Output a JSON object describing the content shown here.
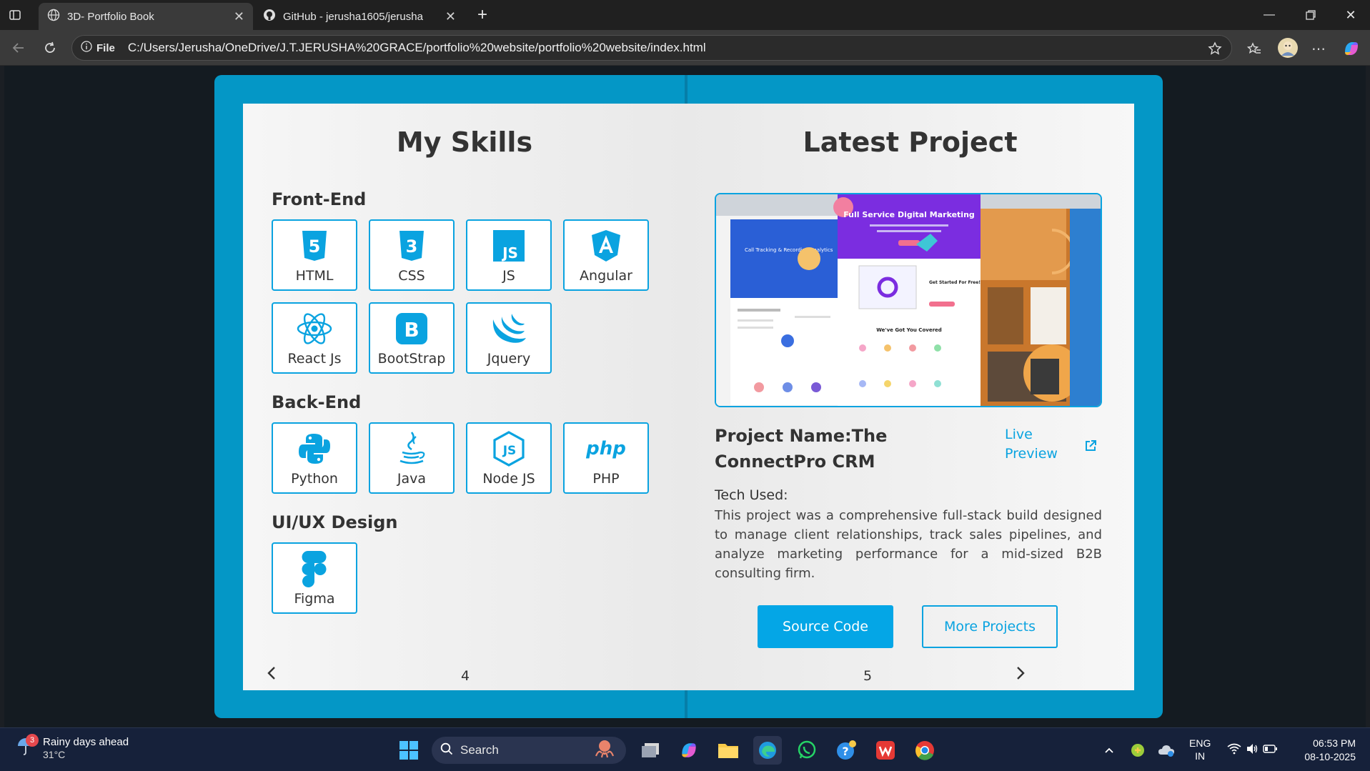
{
  "browser": {
    "tabs": [
      {
        "title": "3D- Portfolio Book",
        "active": true,
        "icon": "globe-icon"
      },
      {
        "title": "GitHub - jerusha1605/jerusha",
        "active": false,
        "icon": "github-icon"
      }
    ],
    "address": {
      "scheme_label": "File",
      "url": "C:/Users/Jerusha/OneDrive/J.T.JERUSHA%20GRACE/portfolio%20website/portfolio%20website/index.html"
    }
  },
  "left_page": {
    "title": "My Skills",
    "sections": {
      "frontend": {
        "title": "Front-End",
        "skills": [
          {
            "label": "HTML",
            "icon": "html5-icon"
          },
          {
            "label": "CSS",
            "icon": "css3-icon"
          },
          {
            "label": "JS",
            "icon": "js-icon"
          },
          {
            "label": "Angular",
            "icon": "angular-icon"
          },
          {
            "label": "React Js",
            "icon": "react-icon"
          },
          {
            "label": "BootStrap",
            "icon": "bootstrap-icon"
          },
          {
            "label": "Jquery",
            "icon": "jquery-icon"
          }
        ]
      },
      "backend": {
        "title": "Back-End",
        "skills": [
          {
            "label": "Python",
            "icon": "python-icon"
          },
          {
            "label": "Java",
            "icon": "java-icon"
          },
          {
            "label": "Node JS",
            "icon": "nodejs-icon"
          },
          {
            "label": "PHP",
            "icon": "php-icon"
          }
        ]
      },
      "uiux": {
        "title": "UI/UX Design",
        "skills": [
          {
            "label": "Figma",
            "icon": "figma-icon"
          }
        ]
      }
    },
    "page_number": "4"
  },
  "right_page": {
    "title": "Latest Project",
    "project_name": "Project Name:The ConnectPro CRM",
    "live_preview": "Live Preview",
    "tech_used_label": "Tech Used:",
    "description": "This project was a comprehensive full-stack build designed to manage client relationships, track sales pipelines, and analyze marketing performance for a mid-sized B2B consulting firm.",
    "image_texts": {
      "banner": "Full Service Digital Marketing",
      "left_card": "Call Tracking & Recording Analytics",
      "started": "Get Started For Free!",
      "covered": "We've Got You Covered"
    },
    "buttons": {
      "source_code": "Source Code",
      "more_projects": "More Projects"
    },
    "page_number": "5"
  },
  "taskbar": {
    "weather": {
      "title": "Rainy days ahead",
      "temp": "31°C",
      "badge": "3"
    },
    "search_placeholder": "Search",
    "lang": {
      "line1": "ENG",
      "line2": "IN"
    },
    "clock": {
      "time": "06:53 PM",
      "date": "08-10-2025"
    }
  },
  "colors": {
    "accent": "#0497c6",
    "skill_border": "#0aa3e0",
    "button": "#04a6e6"
  }
}
